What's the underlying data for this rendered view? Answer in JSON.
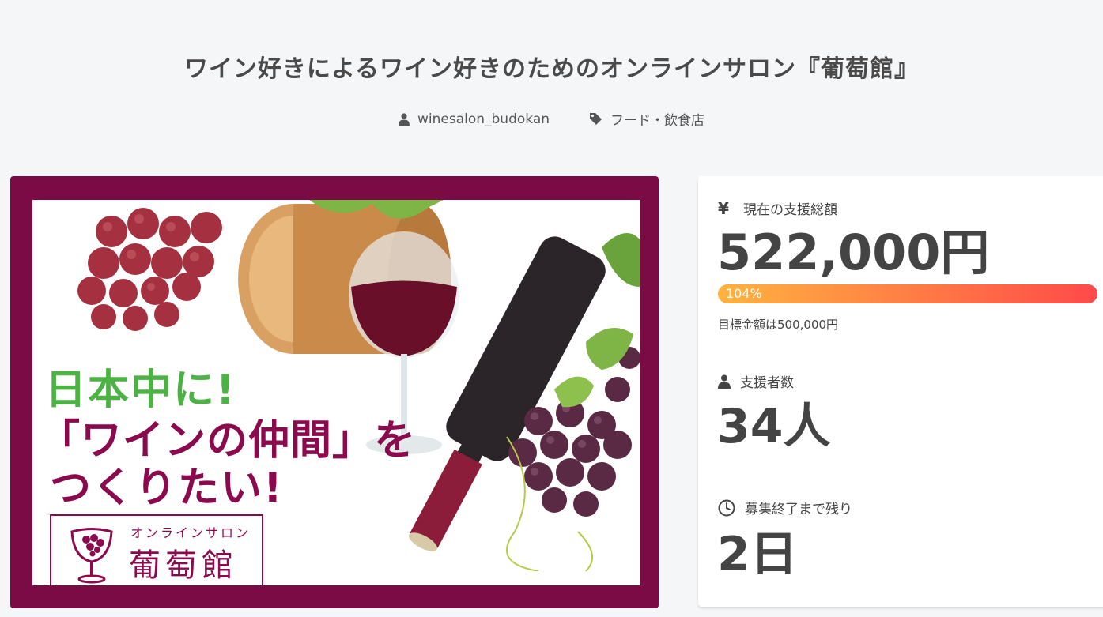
{
  "header": {
    "title": "ワイン好きによるワイン好きのためのオンラインサロン『葡萄館』",
    "owner": "winesalon_budokan",
    "category": "フード・飲食店"
  },
  "hero": {
    "line1": "日本中に!",
    "line2": "「ワインの仲間」を",
    "line3": "つくりたい!",
    "logo_sub": "オンラインサロン",
    "logo_main": "葡萄館"
  },
  "stats": {
    "amount_label": "現在の支援総額",
    "amount_value": "522,000円",
    "progress_text": "104%",
    "progress_fraction": 1.04,
    "goal_text": "目標金額は500,000円",
    "supporters_label": "支援者数",
    "supporters_value": "34人",
    "remaining_label": "募集終了まで残り",
    "remaining_value": "2日"
  },
  "icons": {
    "currency": "¥",
    "owner": "user-icon",
    "category": "tag-icon",
    "supporters": "user-icon",
    "remaining": "clock-icon"
  },
  "colors": {
    "brand_wine": "#7a0b45",
    "accent_green": "#4cb244",
    "progress_start": "#ffb33f",
    "progress_end": "#ff4a4a"
  }
}
